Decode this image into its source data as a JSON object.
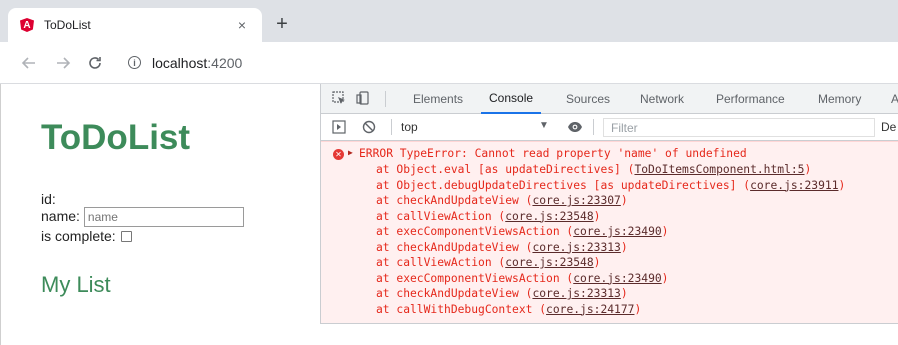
{
  "browser": {
    "tab_title": "ToDoList",
    "tab_close": "×",
    "new_tab": "+",
    "favicon_letter": "A",
    "url_host": "localhost",
    "url_port": ":4200"
  },
  "page": {
    "title": "ToDoList",
    "form": {
      "id_label": "id:",
      "name_label": "name:",
      "name_placeholder": "name",
      "complete_label": "is complete:"
    },
    "list_title": "My List"
  },
  "devtools": {
    "tabs": [
      "Elements",
      "Console",
      "Sources",
      "Network",
      "Performance",
      "Memory",
      "A"
    ],
    "active_tab": "Console",
    "context": "top",
    "filter_placeholder": "Filter",
    "levels_label": "De",
    "error": {
      "message": "ERROR TypeError: Cannot read property 'name' of undefined",
      "stack": [
        {
          "text": "at Object.eval [as updateDirectives] (",
          "link": "ToDoItemsComponent.html:5",
          "end": ")"
        },
        {
          "text": "at Object.debugUpdateDirectives [as updateDirectives] (",
          "link": "core.js:23911",
          "end": ")"
        },
        {
          "text": "at checkAndUpdateView (",
          "link": "core.js:23307",
          "end": ")"
        },
        {
          "text": "at callViewAction (",
          "link": "core.js:23548",
          "end": ")"
        },
        {
          "text": "at execComponentViewsAction (",
          "link": "core.js:23490",
          "end": ")"
        },
        {
          "text": "at checkAndUpdateView (",
          "link": "core.js:23313",
          "end": ")"
        },
        {
          "text": "at callViewAction (",
          "link": "core.js:23548",
          "end": ")"
        },
        {
          "text": "at execComponentViewsAction (",
          "link": "core.js:23490",
          "end": ")"
        },
        {
          "text": "at checkAndUpdateView (",
          "link": "core.js:23313",
          "end": ")"
        },
        {
          "text": "at callWithDebugContext (",
          "link": "core.js:24177",
          "end": ")"
        }
      ]
    }
  },
  "colors": {
    "heading_green": "#3d8b5a",
    "error_red": "#e5281b",
    "error_bg": "#fff0f0",
    "active_tab_blue": "#1a73e8"
  }
}
